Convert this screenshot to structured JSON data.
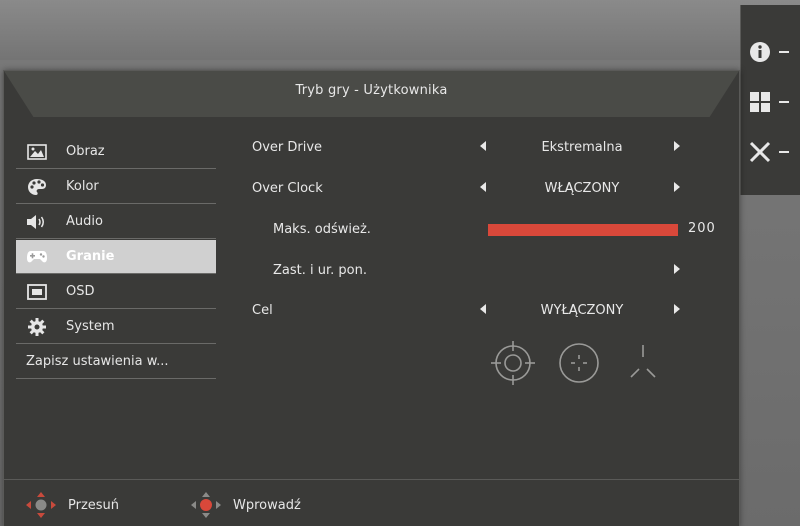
{
  "header": {
    "title": "Tryb gry - Użytkownika"
  },
  "sidebar": {
    "items": [
      {
        "label": "Obraz",
        "icon": "image-icon",
        "active": false
      },
      {
        "label": "Kolor",
        "icon": "palette-icon",
        "active": false
      },
      {
        "label": "Audio",
        "icon": "speaker-icon",
        "active": false
      },
      {
        "label": "Granie",
        "icon": "gamepad-icon",
        "active": true
      },
      {
        "label": "OSD",
        "icon": "osd-icon",
        "active": false
      },
      {
        "label": "System",
        "icon": "gear-icon",
        "active": false
      },
      {
        "label": "Zapisz ustawienia w...",
        "icon": "",
        "active": false
      }
    ]
  },
  "settings": {
    "over_drive": {
      "label": "Over Drive",
      "value": "Ekstremalna"
    },
    "over_clock": {
      "label": "Over Clock",
      "value": "WŁĄCZONY"
    },
    "max_refresh": {
      "label": "Maks. odśwież.",
      "value": "200",
      "level_percent": 100
    },
    "zast": {
      "label": "Zast. i ur. pon."
    },
    "cel": {
      "label": "Cel",
      "value": "WYŁĄCZONY"
    }
  },
  "crosshair_options": [
    "crosshair-circle-icon",
    "crosshair-dot-icon",
    "crosshair-tri-icon"
  ],
  "footer": {
    "move_label": "Przesuń",
    "enter_label": "Wprowadź"
  },
  "rightbar": {
    "items": [
      "info-icon",
      "grid-icon",
      "close-icon"
    ]
  },
  "colors": {
    "accent_red": "#d9483a",
    "panel_bg": "#3a3a38",
    "text": "#e8e8e8"
  }
}
